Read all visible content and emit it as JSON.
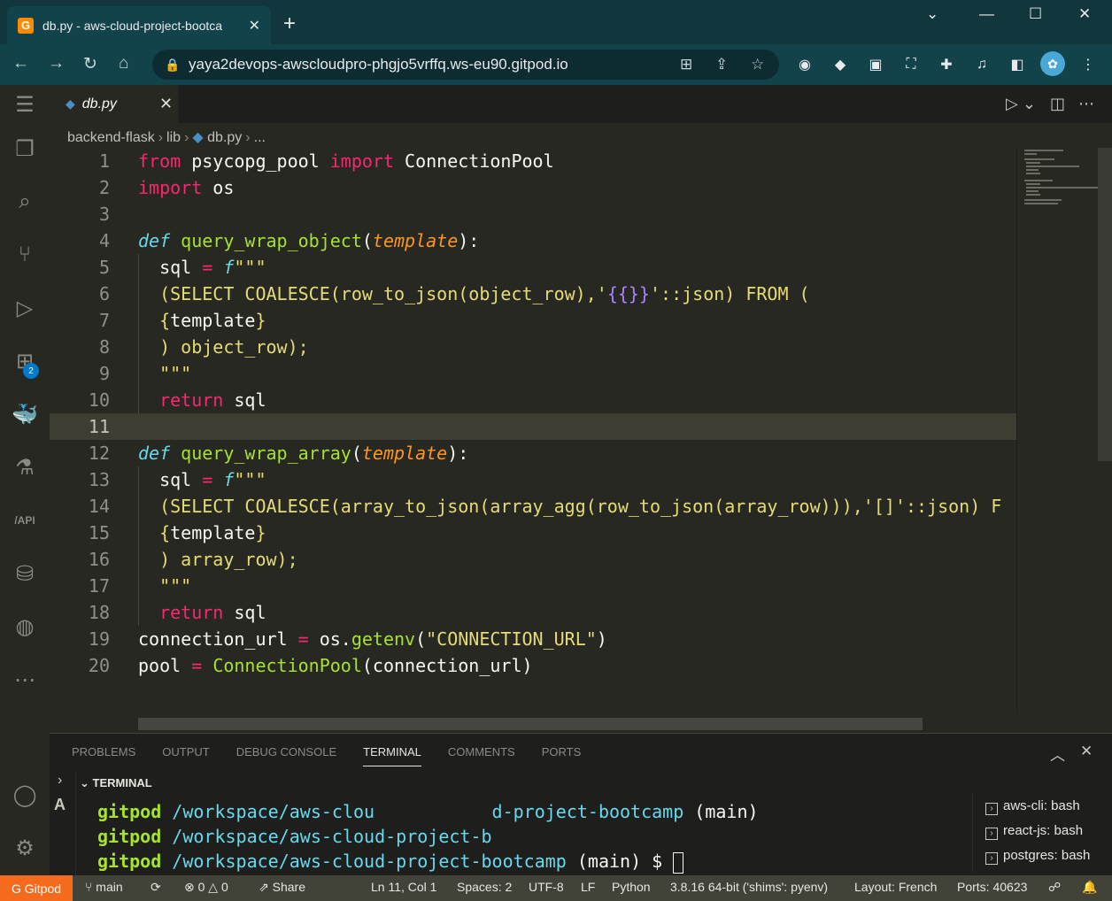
{
  "browser": {
    "tab_title": "db.py - aws-cloud-project-bootca",
    "tab_favicon": "G",
    "url": "yaya2devops-awscloudpro-phgjo5vrffq.ws-eu90.gitpod.io"
  },
  "editor": {
    "tab_label": "db.py",
    "breadcrumb": [
      "backend-flask",
      "lib",
      "db.py",
      "..."
    ],
    "current_line": 11
  },
  "activity": {
    "extensions_badge": "2",
    "api_label": "/API"
  },
  "panel": {
    "tabs": [
      "PROBLEMS",
      "OUTPUT",
      "DEBUG CONSOLE",
      "TERMINAL",
      "COMMENTS",
      "PORTS"
    ],
    "active_tab": "TERMINAL",
    "terminal_header": "TERMINAL",
    "terminal_lines": [
      {
        "user": "gitpod",
        "path": "/workspace/aws-clou           d-project-bootcamp",
        "suffix": " (main)"
      },
      {
        "user": "gitpod",
        "path": "/workspace/aws-cloud-project-b",
        "suffix": ""
      },
      {
        "user": "gitpod",
        "path": "/workspace/aws-cloud-project-bootcamp",
        "suffix": " (main) $ "
      }
    ],
    "terminals": [
      "aws-cli: bash",
      "react-js: bash",
      "postgres: bash"
    ]
  },
  "status": {
    "gitpod": "Gitpod",
    "branch": "main",
    "errors": "0",
    "warnings": "0",
    "share": "Share",
    "position": "Ln 11, Col 1",
    "spaces": "Spaces: 2",
    "encoding": "UTF-8",
    "eol": "LF",
    "language": "Python",
    "interpreter": "3.8.16 64-bit ('shims': pyenv)",
    "layout": "Layout: French",
    "ports": "Ports: 40623"
  },
  "colors": {
    "keyword": "#f92672",
    "function": "#a6e22e",
    "param": "#fd971f",
    "string": "#e6db74",
    "accent": "#f56b1e"
  }
}
